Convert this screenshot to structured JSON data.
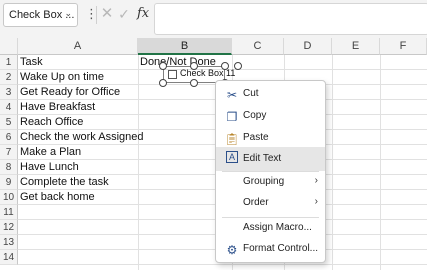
{
  "formula_bar": {
    "name_box": "Check Box ...",
    "name_box_dropdown": "⌄",
    "more_icon": "⋮",
    "cancel_icon": "✕",
    "enter_icon": "✓",
    "fx_label": "fx",
    "formula": ""
  },
  "columns": [
    "A",
    "B",
    "C",
    "D",
    "E",
    "F"
  ],
  "rows": [
    "1",
    "2",
    "3",
    "4",
    "5",
    "6",
    "7",
    "8",
    "9",
    "10",
    "11",
    "12",
    "13",
    "14"
  ],
  "cells": {
    "a1": "Task",
    "b1": "Done/Not Done",
    "a2": "Wake Up on time",
    "a3": "Get Ready for Office",
    "a4": "Have Breakfast",
    "a5": "Reach Office",
    "a6": "Check the work Assigned",
    "a7": "Make a Plan",
    "a8": "Have Lunch",
    "a9": "Complete the task",
    "a10": "Get back home"
  },
  "checkbox": {
    "label": "Check Box 11",
    "checked": false
  },
  "context_menu": {
    "cut": "Cut",
    "copy": "Copy",
    "paste": "Paste",
    "edit_text": "Edit Text",
    "grouping": "Grouping",
    "order": "Order",
    "assign_macro": "Assign Macro...",
    "format_control": "Format Control...",
    "submenu_arrow": "›"
  },
  "colors": {
    "accent": "#217346",
    "menu_highlight": "#e6e6e6"
  }
}
